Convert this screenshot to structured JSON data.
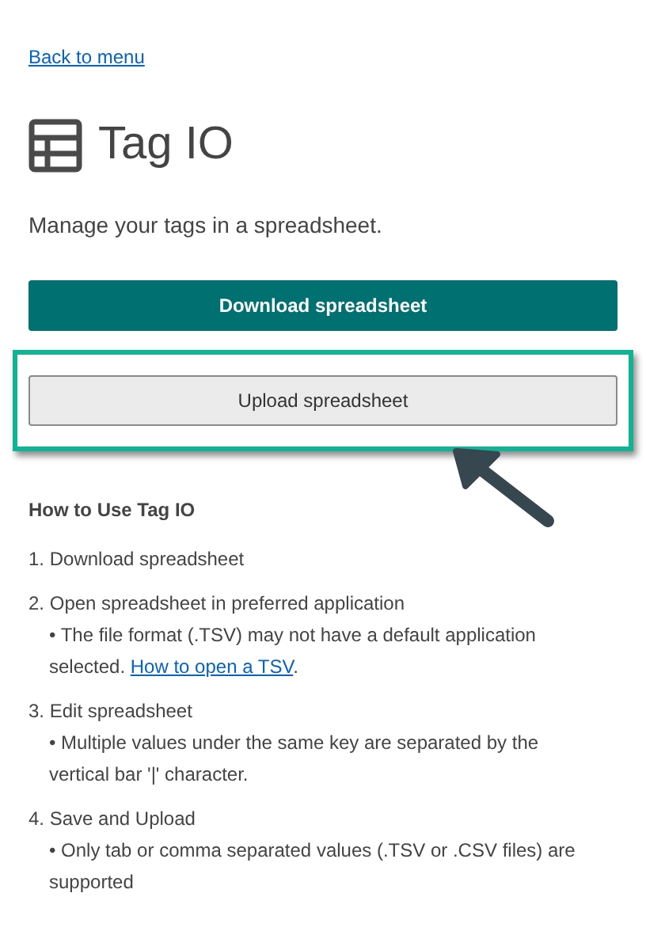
{
  "back_link": "Back to menu",
  "title": "Tag IO",
  "description": "Manage your tags in a spreadsheet.",
  "buttons": [
    {
      "kind": "primary",
      "label": "Download spreadsheet",
      "highlighted": false
    },
    {
      "kind": "secondary",
      "label": "Upload spreadsheet",
      "highlighted": true
    }
  ],
  "instructions": {
    "heading": "How to Use Tag IO",
    "steps": [
      {
        "number": "1.",
        "title": "Download spreadsheet"
      },
      {
        "number": "2.",
        "title": "Open spreadsheet in preferred application",
        "note": "• The file format (.TSV) may not have a default application selected.",
        "link": "How to open a TSV",
        "after_link": "."
      },
      {
        "number": "3.",
        "title": "Edit spreadsheet",
        "note": "• Multiple values under the same key are separated by the vertical bar '|' character."
      },
      {
        "number": "4.",
        "title": "Save and Upload",
        "note": "• Only tab or comma separated values (.TSV or .CSV files) are supported"
      }
    ]
  }
}
